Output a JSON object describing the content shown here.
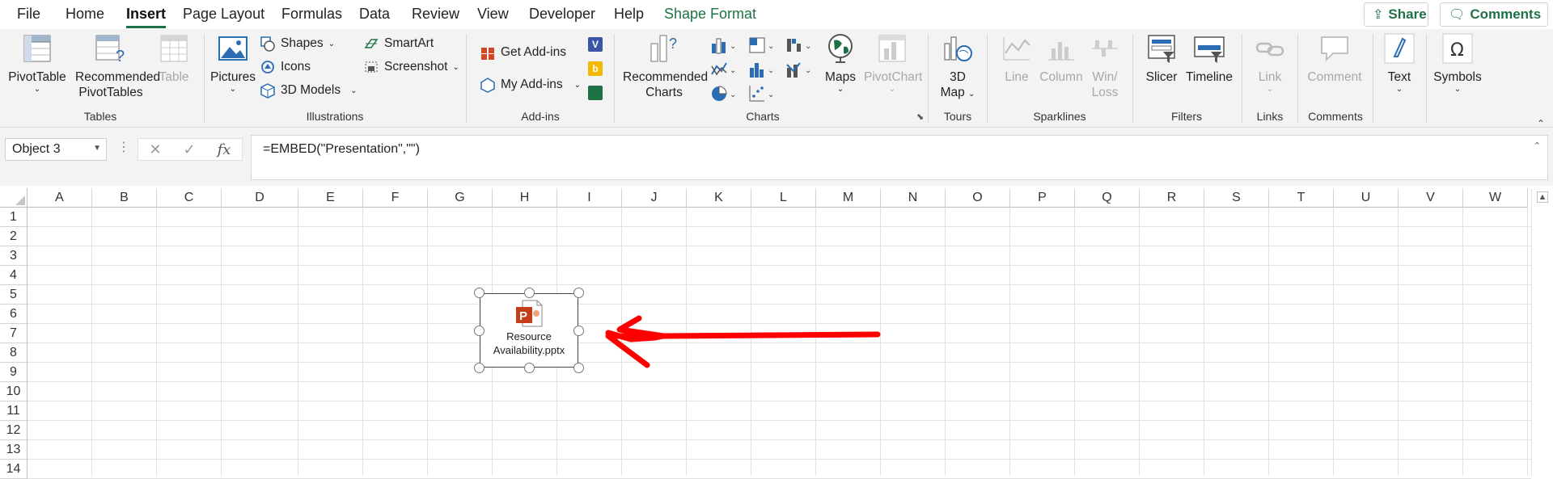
{
  "menu": {
    "tabs": [
      "File",
      "Home",
      "Insert",
      "Page Layout",
      "Formulas",
      "Data",
      "Review",
      "View",
      "Developer",
      "Help",
      "Shape Format"
    ],
    "active": "Insert",
    "share": "Share",
    "comments": "Comments"
  },
  "ribbon": {
    "tables": {
      "label": "Tables",
      "pivottable": "PivotTable",
      "recommended": "Recommended",
      "pivottables": "PivotTables",
      "table": "Table"
    },
    "illustrations": {
      "label": "Illustrations",
      "pictures": "Pictures",
      "shapes": "Shapes",
      "icons": "Icons",
      "models": "3D Models",
      "smartart": "SmartArt",
      "screenshot": "Screenshot"
    },
    "addins": {
      "label": "Add-ins",
      "get": "Get Add-ins",
      "my": "My Add-ins"
    },
    "charts": {
      "label": "Charts",
      "recommended": "Recommended",
      "charts": "Charts",
      "maps": "Maps",
      "pivotchart": "PivotChart"
    },
    "tours": {
      "label": "Tours",
      "map3d": "3D",
      "map": "Map"
    },
    "sparklines": {
      "label": "Sparklines",
      "line": "Line",
      "column": "Column",
      "winloss1": "Win/",
      "winloss2": "Loss"
    },
    "filters": {
      "label": "Filters",
      "slicer": "Slicer",
      "timeline": "Timeline"
    },
    "links": {
      "label": "Links",
      "link": "Link"
    },
    "comments": {
      "label": "Comments",
      "comment": "Comment"
    },
    "text": {
      "label": "Text"
    },
    "symbols": {
      "label": "Symbols"
    }
  },
  "formula_bar": {
    "namebox": "Object 3",
    "fx": "fx",
    "formula": "=EMBED(\"Presentation\",\"\")"
  },
  "grid": {
    "columns": [
      "A",
      "B",
      "C",
      "D",
      "E",
      "F",
      "G",
      "H",
      "I",
      "J",
      "K",
      "L",
      "M",
      "N",
      "O",
      "P",
      "Q",
      "R",
      "S",
      "T",
      "U",
      "V",
      "W"
    ],
    "rows": [
      "1",
      "2",
      "3",
      "4",
      "5",
      "6",
      "7",
      "8",
      "9",
      "10",
      "11",
      "12",
      "13",
      "14"
    ]
  },
  "embedded_object": {
    "line1": "Resource",
    "line2": "Availability.pptx",
    "icon": "powerpoint-file-icon"
  },
  "colors": {
    "accent": "#1e7145",
    "annotation": "#ff0000",
    "powerpoint": "#c43e1c"
  }
}
